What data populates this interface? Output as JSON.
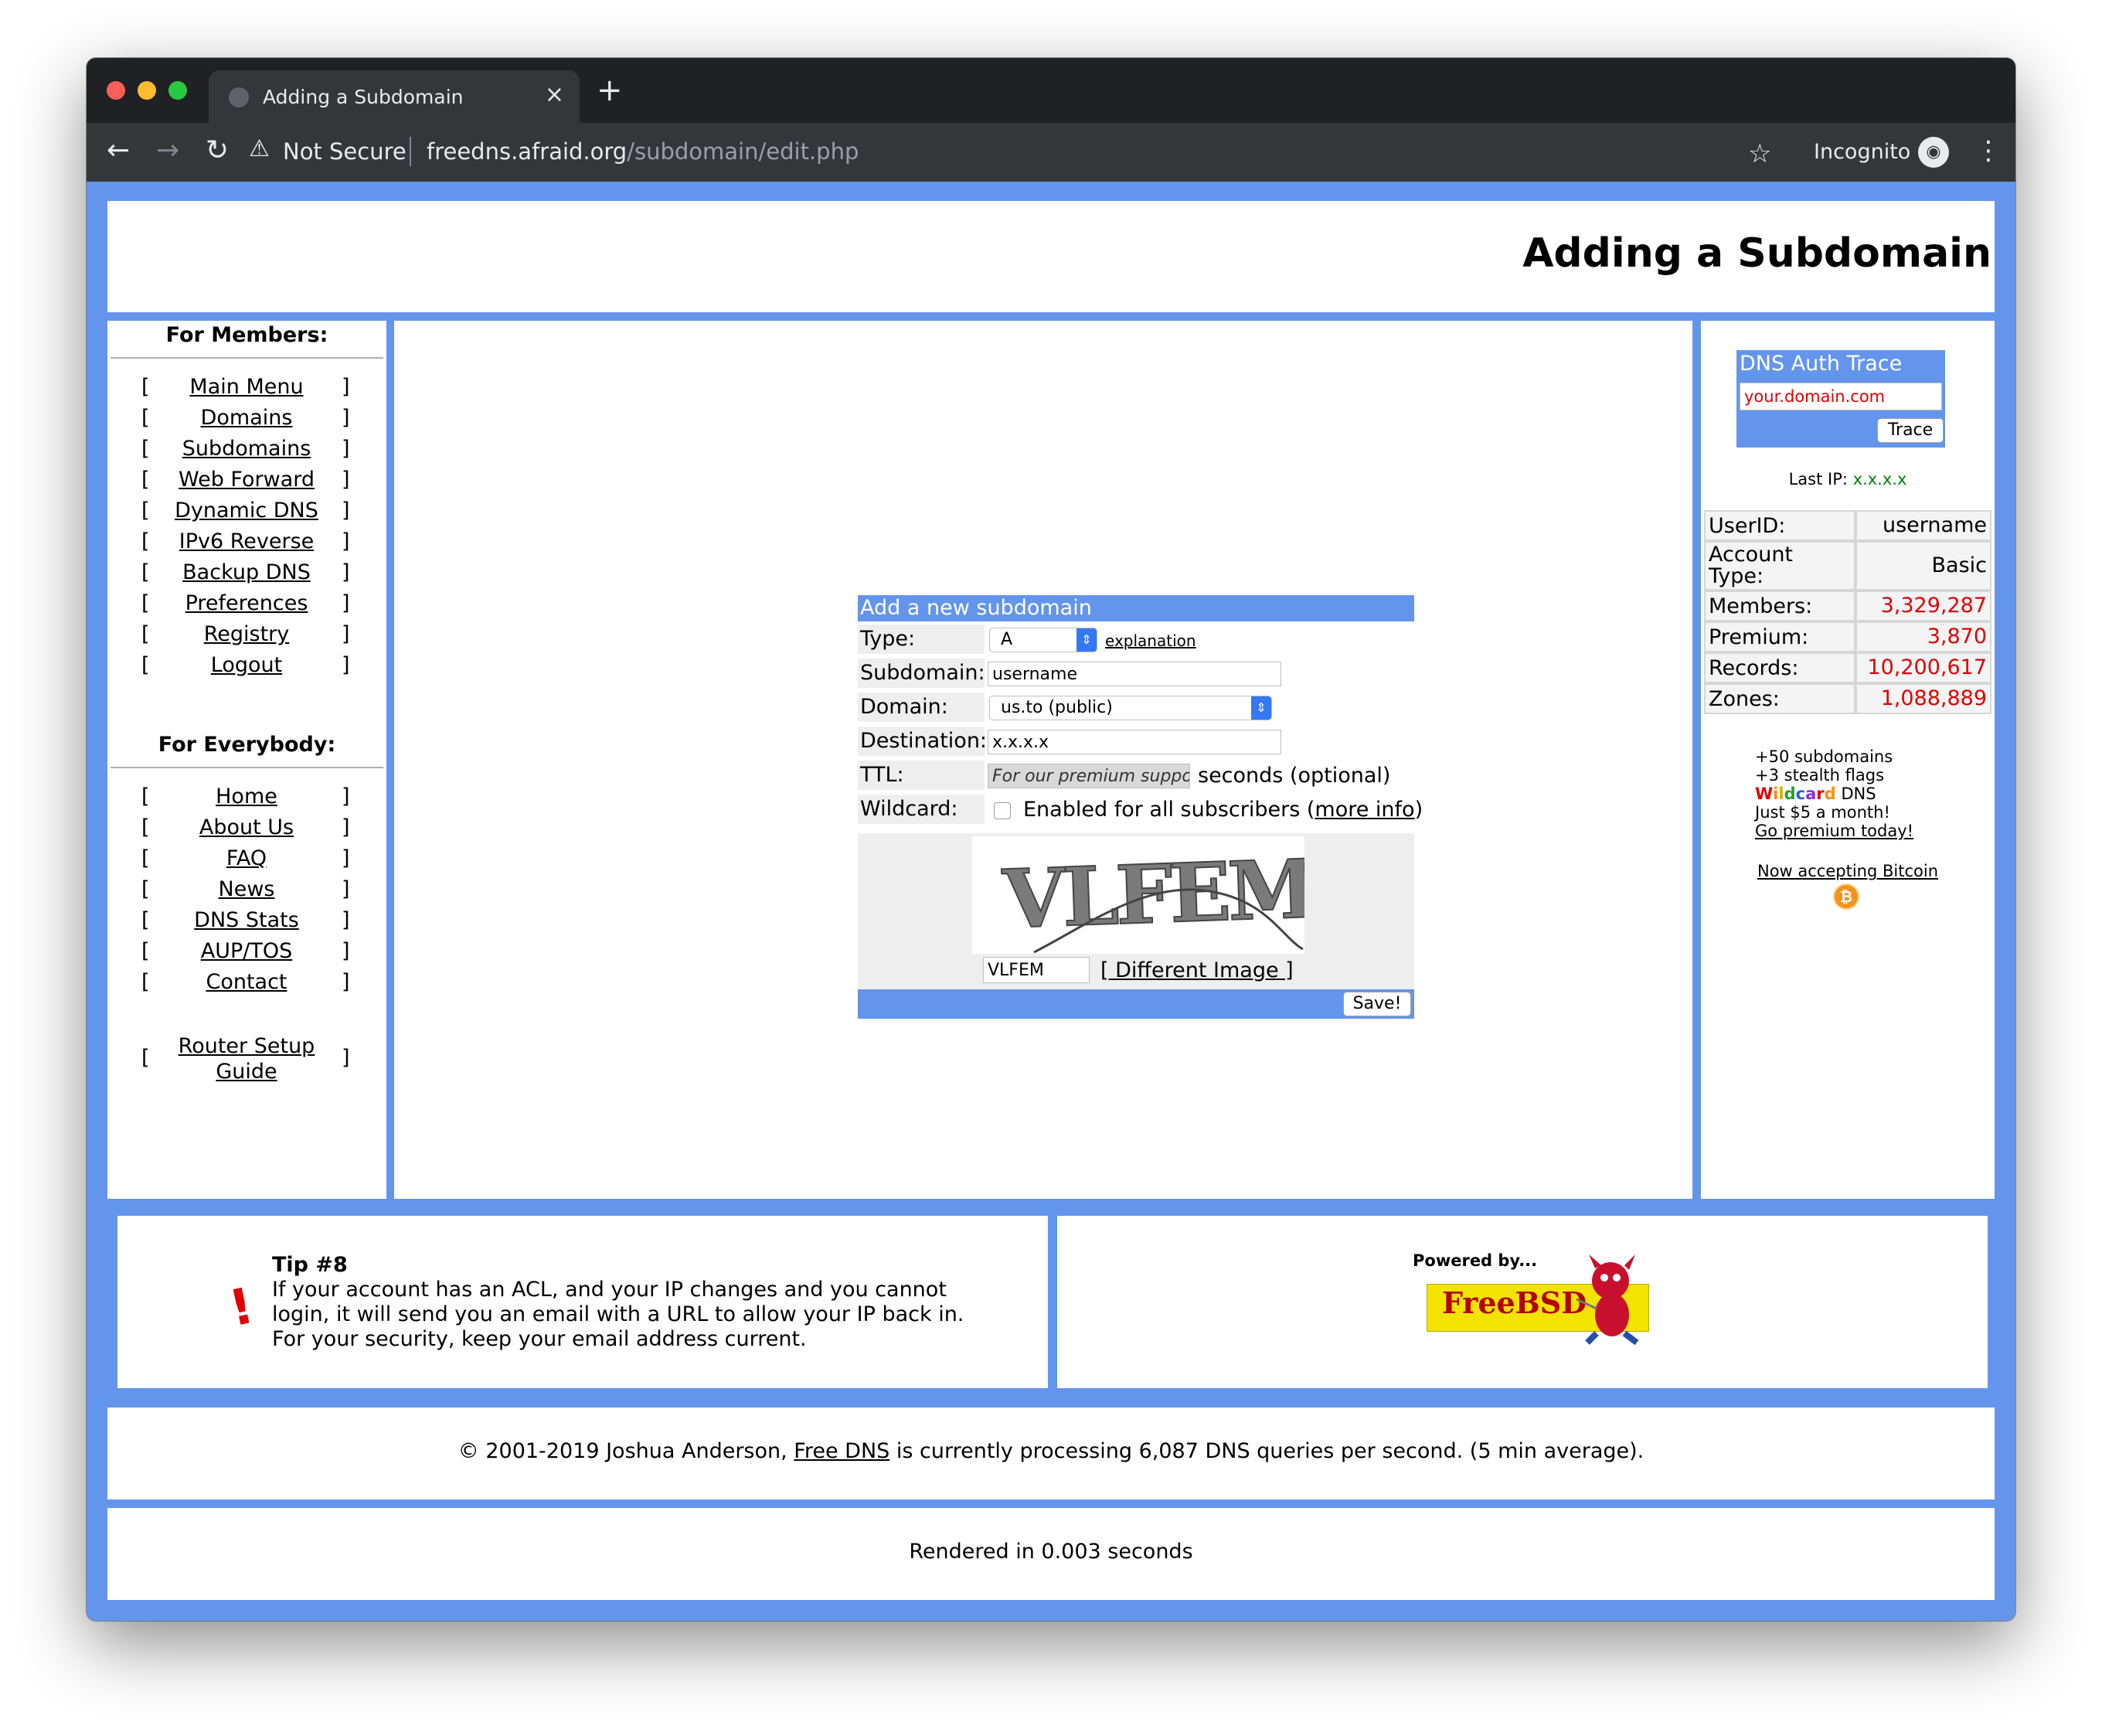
{
  "browser": {
    "tab_title": "Adding a Subdomain",
    "security_label": "Not Secure",
    "url_host": "freedns.afraid.org",
    "url_path": "/subdomain/edit.php",
    "mode_label": "Incognito"
  },
  "header": {
    "title": "Adding a Subdomain"
  },
  "sidebar": {
    "members_heading": "For Members:",
    "members_items": [
      "Main Menu",
      "Domains",
      "Subdomains",
      "Web Forward",
      "Dynamic DNS",
      "IPv6 Reverse",
      "Backup DNS",
      "Preferences",
      "Registry",
      "Logout"
    ],
    "everybody_heading": "For Everybody:",
    "everybody_items": [
      "Home",
      "About Us",
      "FAQ",
      "News",
      "DNS Stats",
      "AUP/TOS",
      "Contact"
    ],
    "router_line1": "Router Setup",
    "router_line2": "Guide",
    "bracket_open": "[",
    "bracket_close": "]"
  },
  "form": {
    "title": "Add a new subdomain",
    "type_label": "Type:",
    "type_value": "A",
    "explanation_link": "explanation",
    "subdomain_label": "Subdomain:",
    "subdomain_value": "username",
    "domain_label": "Domain:",
    "domain_value": "us.to (public)",
    "destination_label": "Destination:",
    "destination_value": "x.x.x.x",
    "ttl_label": "TTL:",
    "ttl_placeholder": "For our premium suppor",
    "ttl_suffix": "seconds (optional)",
    "wildcard_label": "Wildcard:",
    "wildcard_text": "Enabled for all subscribers (",
    "wildcard_link": "more info",
    "wildcard_close": ")",
    "captcha_text": "VLFEM",
    "captcha_input": "VLFEM",
    "different_image": "[ Different Image ]",
    "save_label": "Save!"
  },
  "right": {
    "trace_title": "DNS Auth Trace",
    "trace_placeholder": "your.domain.com",
    "trace_button": "Trace",
    "last_ip_label": "Last IP:",
    "last_ip_value": "x.x.x.x",
    "stats": [
      {
        "label": "UserID:",
        "value": "username",
        "highlight": false
      },
      {
        "label": "Account Type:",
        "value": "Basic",
        "highlight": false
      },
      {
        "label": "Members:",
        "value": "3,329,287",
        "highlight": true
      },
      {
        "label": "Premium:",
        "value": "3,870",
        "highlight": true
      },
      {
        "label": "Records:",
        "value": "10,200,617",
        "highlight": true
      },
      {
        "label": "Zones:",
        "value": "1,088,889",
        "highlight": true
      }
    ],
    "promo_line1": "+50 subdomains",
    "promo_line2": "+3 stealth flags",
    "promo_wildcard": "Wildcard",
    "promo_dns": "DNS",
    "promo_price": "Just $5 a month!",
    "promo_link": "Go premium today!",
    "bitcoin_link": "Now accepting Bitcoin"
  },
  "tip": {
    "title": "Tip #8",
    "line1": "If your account has an ACL, and your IP changes and you cannot",
    "line2": "login, it will send you an email with a URL to allow your IP back in.",
    "line3": "For your security, keep your email address current."
  },
  "freebsd": {
    "powered": "Powered by...",
    "name": "FreeBSD"
  },
  "footer": {
    "copyright_prefix": "© 2001-2019 Joshua Anderson, ",
    "free_dns_link": "Free DNS",
    "copyright_suffix": " is currently processing 6,087 DNS queries per second. (5 min average).",
    "rendered": "Rendered in 0.003 seconds"
  },
  "colors": {
    "frame_blue": "#6495ed",
    "stat_red": "#e00000",
    "ip_green": "#008000"
  }
}
